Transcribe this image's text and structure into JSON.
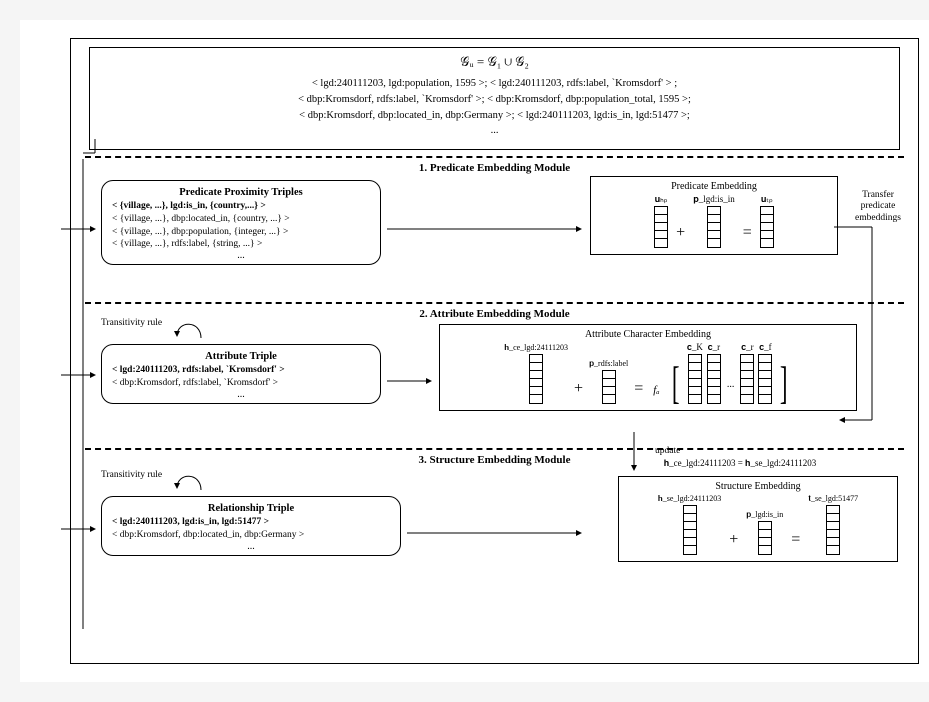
{
  "header": {
    "formula": "𝒢ᵤ = 𝒢₁ ∪ 𝒢₂",
    "triples": [
      "< lgd:240111203,  lgd:population, 1595 >; < lgd:240111203, rdfs:label, `Kromsdorf' > ;",
      "< dbp:Kromsdorf, rdfs:label, `Kromsdorf' >; < dbp:Kromsdorf, dbp:population_total, 1595 >;",
      "< dbp:Kromsdorf, dbp:located_in, dbp:Germany >;  < lgd:240111203, lgd:is_in, lgd:51477 >;",
      "..."
    ]
  },
  "module1": {
    "title": "1. Predicate Embedding Module",
    "left": {
      "title": "Predicate Proximity Triples",
      "rows": [
        "< {village, ...}, lgd:is_in, {country,...} >",
        "< {village, ...}, dbp:located_in, {country, ...} >",
        "< {village, ...}, dbp:population, {integer, ...} >",
        "< {village, ...}, rdfs:label, {string, ...} >",
        "..."
      ]
    },
    "right": {
      "title": "Predicate Embedding",
      "labels": {
        "l1": "𝐮ₕₚ",
        "l2": "𝐩_lgd:is_in",
        "l3": "𝐮ₜₚ"
      }
    },
    "side": "Transfer predicate embeddings",
    "side_arrow_label": ""
  },
  "module2": {
    "title": "2. Attribute Embedding Module",
    "trans": "Transitivity rule",
    "left": {
      "title": "Attribute Triple",
      "rows": [
        "< lgd:240111203, rdfs:label, `Kromsdorf' >",
        "< dbp:Kromsdorf, rdfs:label, `Kromsdorf' >",
        "..."
      ]
    },
    "right": {
      "title": "Attribute Character Embedding",
      "labels": {
        "h": "𝐡_ce_lgd:24111203",
        "p": "𝐩_rdfs:label",
        "ck": "𝐜_K",
        "cr1": "𝐜_r",
        "cr2": "𝐜_r",
        "cf": "𝐜_f"
      },
      "fa": "fₐ"
    }
  },
  "module3": {
    "title": "3. Structure Embedding Module",
    "trans": "Transitivity rule",
    "update": "update",
    "update_eq": "𝐡_ce_lgd:24111203  =  𝐡_se_lgd:24111203",
    "left": {
      "title": "Relationship Triple",
      "rows": [
        "< lgd:240111203, lgd:is_in, lgd:51477 >",
        "< dbp:Kromsdorf, dbp:located_in, dbp:Germany >",
        "..."
      ]
    },
    "right": {
      "title": "Structure Embedding",
      "labels": {
        "l1": "𝐡_se_lgd:24111203",
        "l2": "𝐩_lgd:is_in",
        "l3": "𝐭_se_lgd:51477"
      }
    }
  }
}
